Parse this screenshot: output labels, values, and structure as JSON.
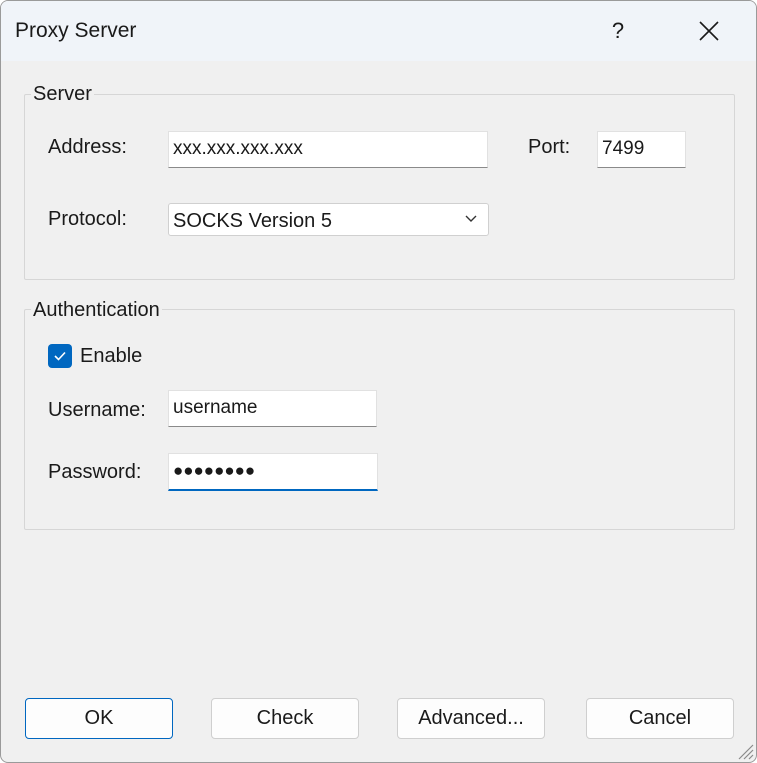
{
  "window": {
    "title": "Proxy Server",
    "help_label": "?"
  },
  "server": {
    "group_label": "Server",
    "address_label": "Address:",
    "address_value": "xxx.xxx.xxx.xxx",
    "port_label": "Port:",
    "port_value": "7499",
    "protocol_label": "Protocol:",
    "protocol_selected": "SOCKS Version 5"
  },
  "authentication": {
    "group_label": "Authentication",
    "enable_label": "Enable",
    "enable_checked": true,
    "username_label": "Username:",
    "username_value": "username",
    "password_label": "Password:",
    "password_mask": "●●●●●●●●"
  },
  "buttons": {
    "ok": "OK",
    "check": "Check",
    "advanced": "Advanced...",
    "cancel": "Cancel"
  },
  "colors": {
    "accent": "#0067c0"
  }
}
